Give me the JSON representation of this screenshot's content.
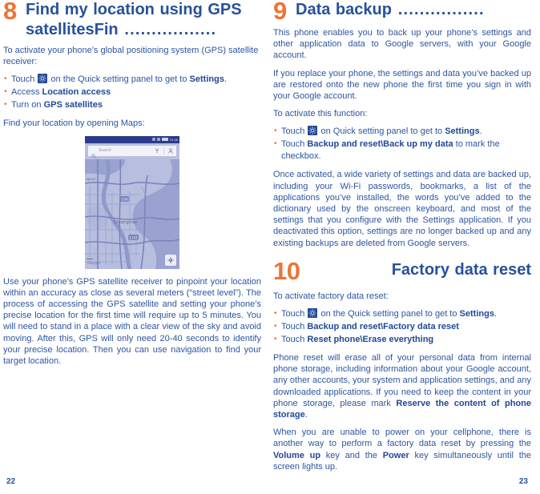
{
  "document": {
    "page_left": "22",
    "page_right": "23",
    "accent_orange": "#ee7434",
    "accent_blue": "#26519b",
    "body_blue": "#2c55a2"
  },
  "left_column": {
    "section": {
      "number": "8",
      "title": "Find my location using GPS satellitesFin",
      "dots": " ................."
    },
    "intro": "To activate your phone’s global positioning system (GPS) satellite receiver:",
    "bullets": [
      {
        "pre": "Touch ",
        "icon": "gear-icon",
        "mid": " on the Quick setting panel to get to ",
        "bold": "Settings",
        "post": "."
      },
      {
        "pre": "Access ",
        "icon": "",
        "mid": "",
        "bold": "Location access",
        "post": ""
      },
      {
        "pre": "Turn on ",
        "icon": "",
        "mid": "",
        "bold": "GPS satellites",
        "post": ""
      }
    ],
    "after_bullets": "Find your location by opening Maps:",
    "map_screenshot": {
      "status_time": "21:05",
      "search_placeholder": "Search",
      "watermark": "Google",
      "search_icon": "search-icon",
      "directions_icon": "directions-icon",
      "account_icon": "account-icon",
      "locate_icon": "locate-me-icon",
      "place_label": "Chiangmai",
      "road_label_1": "106",
      "road_label_2": "1141"
    },
    "paragraphs": [
      "Use your phone’s GPS satellite receiver to pinpoint your location within an accuracy as close as several meters (“street level”). The process of accessing the GPS satellite and setting your phone’s precise location for the first time will require up to 5 minutes. You will need to stand in a place with a clear view of the sky and avoid moving. After this, GPS will only need 20-40 seconds to identify your precise location. Then you can use navigation to find your target location."
    ]
  },
  "right_column": {
    "section_9": {
      "number": "9",
      "title": "Data backup",
      "dots": " ................"
    },
    "s9_paragraphs": [
      "This phone enables you to back up your phone’s settings and other application data to Google servers, with your Google account.",
      "If you replace your phone, the settings and data you’ve backed up are restored onto the new phone the first time you sign in with your Google account."
    ],
    "s9_activate_label": "To activate this function:",
    "s9_bullets": [
      {
        "pre": "Touch ",
        "icon": "gear-icon",
        "mid": " on Quick setting panel to get to ",
        "bold": "Settings",
        "post": "."
      },
      {
        "pre": "Touch ",
        "icon": "",
        "mid": "",
        "bold": "Backup and reset\\Back up my data",
        "post": " to mark the checkbox."
      }
    ],
    "s9_closing": "Once activated, a wide variety of settings and data are backed up, including your Wi-Fi passwords, bookmarks, a list of the applications you’ve installed, the words you’ve added to the dictionary used by the onscreen keyboard, and most of the settings that you configure with the Settings application. If you deactivated this option, settings are no longer backed up and any existing backups are deleted from Google servers.",
    "section_10": {
      "number": "10",
      "title": "Factory data reset",
      "dots": ""
    },
    "s10_activate_label": "To activate factory data reset:",
    "s10_bullets": [
      {
        "pre": "Touch ",
        "icon": "gear-icon",
        "mid": " on the Quick setting panel to get to ",
        "bold": "Settings",
        "post": "."
      },
      {
        "pre": "Touch ",
        "icon": "",
        "mid": "",
        "bold": "Backup and reset\\Factory data reset",
        "post": ""
      },
      {
        "pre": "Touch ",
        "icon": "",
        "mid": "",
        "bold": "Reset phone\\Erase everything",
        "post": ""
      }
    ],
    "s10_paragraph_1_a": "Phone reset will erase all of your personal data from internal phone storage, including information about your Google account, any other accounts, your system and application settings, and any downloaded applications. If you need to keep the content in your phone storage, please mark ",
    "s10_paragraph_1_b": "Reserve the content of phone storage",
    "s10_paragraph_1_c": ".",
    "s10_paragraph_2_a": "When you are unable to power on your cellphone, there is another way to perform a factory data reset by pressing the ",
    "s10_paragraph_2_b": "Volume up",
    "s10_paragraph_2_c": " key and the ",
    "s10_paragraph_2_d": "Power",
    "s10_paragraph_2_e": " key simultaneously until the screen lights up."
  }
}
